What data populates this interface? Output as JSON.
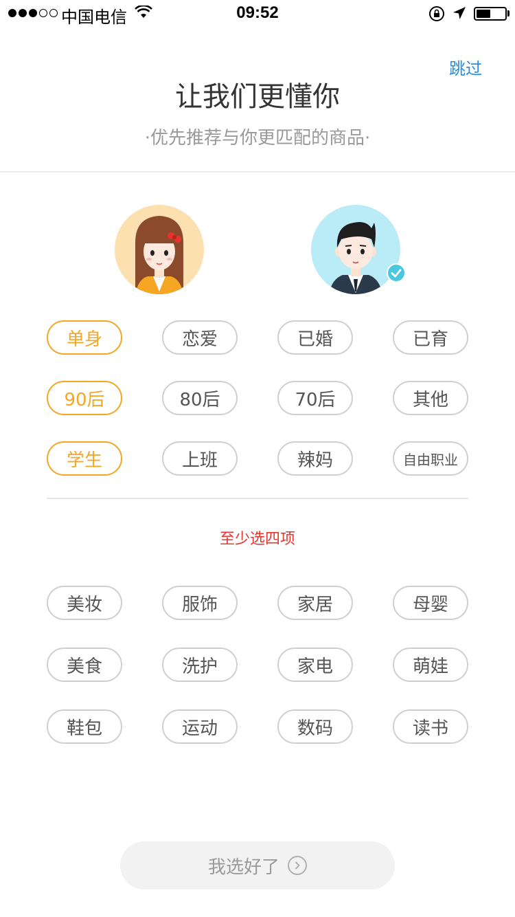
{
  "status_bar": {
    "carrier": "中国电信",
    "time": "09:52",
    "signal_bars_filled": 3,
    "signal_bars_total": 5,
    "battery_level": 0.5
  },
  "header": {
    "skip_label": "跳过",
    "title": "让我们更懂你",
    "subtitle": "·优先推荐与你更匹配的商品·"
  },
  "avatars": [
    {
      "id": "female",
      "icon": "female-avatar-icon",
      "selected": false
    },
    {
      "id": "male",
      "icon": "male-avatar-icon",
      "selected": true
    }
  ],
  "profile_tags": [
    {
      "label": "单身",
      "selected": true
    },
    {
      "label": "恋爱",
      "selected": false
    },
    {
      "label": "已婚",
      "selected": false
    },
    {
      "label": "已育",
      "selected": false
    },
    {
      "label": "90后",
      "selected": true
    },
    {
      "label": "80后",
      "selected": false
    },
    {
      "label": "70后",
      "selected": false
    },
    {
      "label": "其他",
      "selected": false
    },
    {
      "label": "学生",
      "selected": true
    },
    {
      "label": "上班",
      "selected": false
    },
    {
      "label": "辣妈",
      "selected": false
    },
    {
      "label": "自由职业",
      "selected": false
    }
  ],
  "hint": "至少选四项",
  "interest_tags": [
    {
      "label": "美妆",
      "selected": false
    },
    {
      "label": "服饰",
      "selected": false
    },
    {
      "label": "家居",
      "selected": false
    },
    {
      "label": "母婴",
      "selected": false
    },
    {
      "label": "美食",
      "selected": false
    },
    {
      "label": "洗护",
      "selected": false
    },
    {
      "label": "家电",
      "selected": false
    },
    {
      "label": "萌娃",
      "selected": false
    },
    {
      "label": "鞋包",
      "selected": false
    },
    {
      "label": "运动",
      "selected": false
    },
    {
      "label": "数码",
      "selected": false
    },
    {
      "label": "读书",
      "selected": false
    }
  ],
  "done_button": {
    "label": "我选好了",
    "enabled": false
  },
  "colors": {
    "accent_selected": "#f5a623",
    "hint_red": "#e8332d",
    "skip_blue": "#2a8cdc",
    "check_cyan": "#4ac8e0"
  }
}
